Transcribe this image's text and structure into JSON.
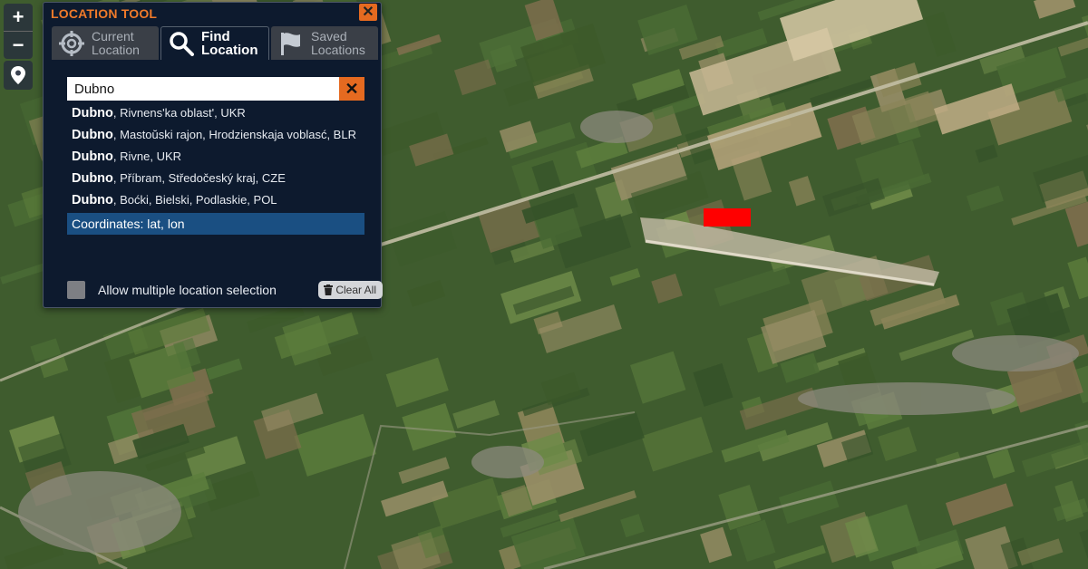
{
  "map": {
    "zoom_in_label": "+",
    "zoom_out_label": "−",
    "pin_icon": "map-pin-icon",
    "target_color": "#ff0000"
  },
  "panel": {
    "title": "LOCATION TOOL",
    "close_label": "✕",
    "tabs": [
      {
        "label": "Current\nLocation",
        "icon": "crosshair-icon",
        "active": false
      },
      {
        "label": "Find\nLocation",
        "icon": "search-icon",
        "active": true
      },
      {
        "label": "Saved\nLocations",
        "icon": "flag-icon",
        "active": false
      }
    ],
    "search": {
      "value": "Dubno",
      "clear_label": "✕"
    },
    "results": [
      {
        "name": "Dubno",
        "detail": ", Rivnens'ka oblast', UKR"
      },
      {
        "name": "Dubno",
        "detail": ", Mastoŭski rajon, Hrodzienskaja voblasć, BLR"
      },
      {
        "name": "Dubno",
        "detail": ", Rivne, UKR"
      },
      {
        "name": "Dubno",
        "detail": ", Příbram, Středočeský kraj, CZE"
      },
      {
        "name": "Dubno",
        "detail": ", Boćki, Bielski, Podlaskie, POL"
      }
    ],
    "coordinates_label": "Coordinates: lat, lon",
    "multi_select_label": "Allow multiple location selection",
    "clear_all_label": "Clear All",
    "accent_color": "#e56a20"
  }
}
